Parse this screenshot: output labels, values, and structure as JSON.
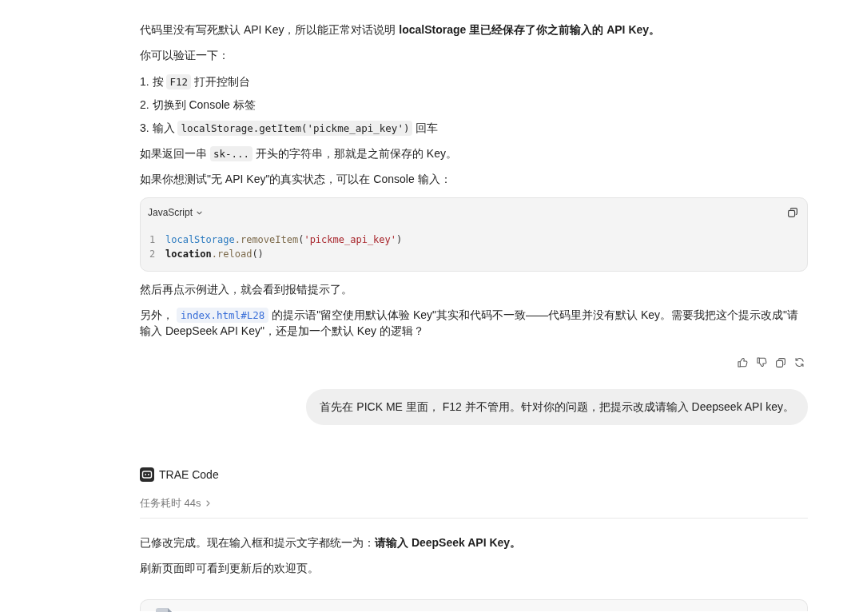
{
  "assistant_reply": {
    "blocks": [
      {
        "kind": "paragraph",
        "segments": [
          {
            "kind": "text",
            "text": "代码里没有写死默认 API Key，所以能正常对话说明 **localStorage 里已经保存了你之前输入的 API Key。**"
          }
        ]
      },
      {
        "kind": "paragraph",
        "segments": [
          {
            "kind": "text",
            "text": "你可以验证一下："
          }
        ]
      },
      {
        "kind": "list",
        "items": [
          {
            "number": "1.",
            "segments": [
              {
                "kind": "text",
                "text": "按 "
              },
              {
                "kind": "code",
                "text": "F12"
              },
              {
                "kind": "text",
                "text": " 打开控制台"
              }
            ]
          },
          {
            "number": "2.",
            "segments": [
              {
                "kind": "text",
                "text": "切换到 Console 标签"
              }
            ]
          },
          {
            "number": "3.",
            "segments": [
              {
                "kind": "text",
                "text": "输入 "
              },
              {
                "kind": "code",
                "text": "localStorage.getItem('pickme_api_key')"
              },
              {
                "kind": "text",
                "text": " 回车"
              }
            ]
          }
        ]
      },
      {
        "kind": "paragraph",
        "segments": [
          {
            "kind": "text",
            "text": "如果返回一串 "
          },
          {
            "kind": "code",
            "text": "sk-..."
          },
          {
            "kind": "text",
            "text": " 开头的字符串，那就是之前保存的 Key。"
          }
        ]
      },
      {
        "kind": "paragraph",
        "segments": [
          {
            "kind": "text",
            "text": "如果你想测试\"无 API Key\"的真实状态，可以在 Console 输入："
          }
        ]
      },
      {
        "kind": "code_block",
        "language": "JavaScript",
        "lines": [
          {
            "number": "1",
            "tokens": [
              {
                "kind": "builtin",
                "text": "localStorage"
              },
              {
                "kind": "method",
                "text": ".removeItem"
              },
              {
                "kind": "punctuation",
                "text": "("
              },
              {
                "kind": "string",
                "text": "'pickme_api_key'"
              },
              {
                "kind": "punctuation",
                "text": ")"
              }
            ]
          },
          {
            "number": "2",
            "tokens": [
              {
                "kind": "variable",
                "text": "location"
              },
              {
                "kind": "method",
                "text": ".reload"
              },
              {
                "kind": "punctuation",
                "text": "()"
              }
            ]
          }
        ]
      },
      {
        "kind": "paragraph",
        "segments": [
          {
            "kind": "text",
            "text": "然后再点示例进入，就会看到报错提示了。"
          }
        ]
      },
      {
        "kind": "paragraph",
        "segments": [
          {
            "kind": "text",
            "text": "另外， "
          },
          {
            "kind": "link",
            "text": "index.html#L28"
          },
          {
            "kind": "text",
            "text": " 的提示语\"留空使用默认体验 Key\"其实和代码不一致——代码里并没有默认 Key。需要我把这个提示改成\"请输入 DeepSeek API Key\"，还是加一个默认 Key 的逻辑？"
          }
        ]
      }
    ]
  },
  "user_message": {
    "text": "首先在 PICK ME 里面， F12 并不管用。针对你的问题，把提示改成请输入 Deepseek API key。"
  },
  "agent_reply": {
    "name": "TRAE Code",
    "duration": "任务耗时 44s",
    "expanded": false,
    "blocks": [
      {
        "kind": "paragraph",
        "segments": [
          {
            "kind": "text",
            "text": "已修改完成。现在输入框和提示文字都统一为：**请输入 DeepSeek API Key。**"
          }
        ]
      },
      {
        "kind": "paragraph",
        "segments": [
          {
            "kind": "text",
            "text": "刷新页面即可看到更新后的欢迎页。"
          }
        ]
      }
    ]
  }
}
